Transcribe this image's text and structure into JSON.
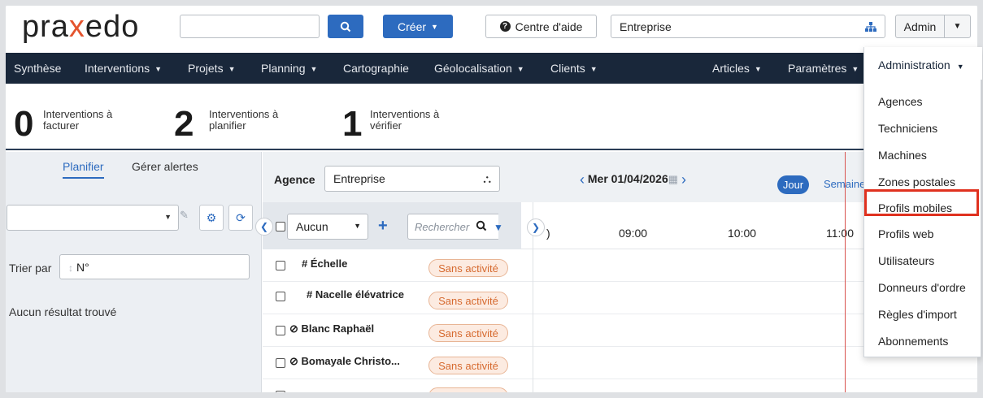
{
  "header": {
    "logo_text_a": "pra",
    "logo_text_x": "x",
    "logo_text_b": "edo",
    "search_value": "",
    "create_label": "Créer",
    "help_label": "Centre d'aide",
    "entreprise_label": "Entreprise",
    "admin_label": "Admin"
  },
  "nav": {
    "items": [
      {
        "label": "Synthèse"
      },
      {
        "label": "Interventions"
      },
      {
        "label": "Projets"
      },
      {
        "label": "Planning"
      },
      {
        "label": "Cartographie"
      },
      {
        "label": "Géolocalisation"
      },
      {
        "label": "Clients"
      },
      {
        "label": "Articles"
      },
      {
        "label": "Paramètres"
      }
    ]
  },
  "counters": [
    {
      "count": "0",
      "line1": "Interventions à",
      "line2": "facturer"
    },
    {
      "count": "2",
      "line1": "Interventions à",
      "line2": "planifier"
    },
    {
      "count": "1",
      "line1": "Interventions à",
      "line2": "vérifier"
    }
  ],
  "left_panel": {
    "tabs": [
      {
        "label": "Planifier"
      },
      {
        "label": "Gérer alertes"
      }
    ],
    "sort_label": "Trier par",
    "sort_value": "N°",
    "empty_text": "Aucun résultat trouvé"
  },
  "toolbar": {
    "agence_label": "Agence",
    "agence_value": "Entreprise",
    "date": "Mer 01/04/2026",
    "jour_label": "Jour",
    "semaine_label": "Semaine"
  },
  "list": {
    "select_value": "Aucun",
    "search_placeholder": "Rechercher",
    "rows": [
      {
        "name": "# Échelle",
        "status": "Sans activité"
      },
      {
        "name": "# Nacelle élévatrice",
        "status": "Sans activité"
      },
      {
        "name": "Blanc Raphaël",
        "status": "Sans activité"
      },
      {
        "name": "Bomayale Christo...",
        "status": "Sans activité"
      }
    ]
  },
  "timeline": {
    "labels": [
      "09:00",
      "10:00",
      "11:00"
    ]
  },
  "admin_menu": {
    "title": "Administration",
    "items": [
      {
        "label": "Agences"
      },
      {
        "label": "Techniciens"
      },
      {
        "label": "Machines"
      },
      {
        "label": "Zones postales"
      },
      {
        "label": "Profils mobiles"
      },
      {
        "label": "Profils web"
      },
      {
        "label": "Utilisateurs"
      },
      {
        "label": "Donneurs d'ordre"
      },
      {
        "label": "Règles d'import"
      },
      {
        "label": "Abonnements"
      }
    ]
  },
  "colors": {
    "primary": "#2d6bbf",
    "nav_bg": "#19273a",
    "badge_text": "#d66a2f",
    "highlight": "#e0311f",
    "now_line": "#d9534f"
  }
}
